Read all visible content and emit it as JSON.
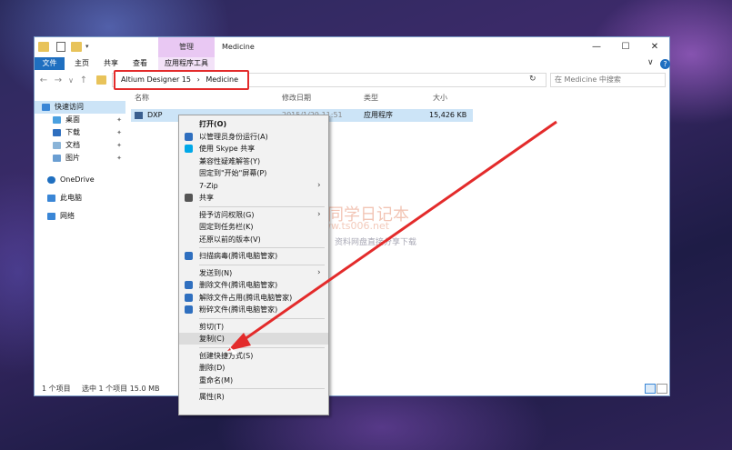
{
  "window": {
    "title": "Medicine",
    "context_tab_top": "管理",
    "controls": {
      "minimize": "—",
      "maximize": "☐",
      "close": "✕"
    },
    "chevron": "∨",
    "help": "?"
  },
  "ribbon": {
    "tabs": [
      "文件",
      "主页",
      "共享",
      "查看"
    ],
    "context_tab": "应用程序工具"
  },
  "address": {
    "crumbs": [
      "Altium Designer 15",
      "›",
      "Medicine"
    ],
    "search_placeholder": "在 Medicine 中搜索",
    "nav": {
      "back": "←",
      "forward": "→",
      "up": "↑",
      "down": "∨",
      "refresh": "↻"
    }
  },
  "nav_pane": {
    "quick_access": "快速访问",
    "items": [
      "桌面",
      "下载",
      "文档",
      "图片"
    ],
    "pin": "✦",
    "onedrive": "OneDrive",
    "thispc": "此电脑",
    "network": "网络"
  },
  "columns": {
    "name": "名称",
    "date": "修改日期",
    "type": "类型",
    "size": "大小"
  },
  "file": {
    "name": "DXP",
    "date": "2015/1/29 11:51",
    "type": "应用程序",
    "size": "15,426 KB"
  },
  "status": {
    "count": "1 个项目",
    "selected": "选中 1 个项目  15.0 MB"
  },
  "context_menu": {
    "items": [
      {
        "label": "打开(O)",
        "bold": true
      },
      {
        "label": "以管理员身份运行(A)",
        "icon": "shield-icon"
      },
      {
        "label": "使用 Skype 共享",
        "icon": "skype-icon"
      },
      {
        "label": "兼容性疑难解答(Y)"
      },
      {
        "label": "固定到\"开始\"屏幕(P)"
      },
      {
        "label": "7-Zip",
        "submenu": true
      },
      {
        "label": "共享",
        "icon": "share-icon"
      },
      {
        "sep": true
      },
      {
        "label": "授予访问权限(G)",
        "submenu": true
      },
      {
        "label": "固定到任务栏(K)"
      },
      {
        "label": "还原以前的版本(V)"
      },
      {
        "sep": true
      },
      {
        "label": "扫描病毒(腾讯电脑管家)",
        "icon": "scan-icon"
      },
      {
        "sep": true
      },
      {
        "label": "发送到(N)",
        "submenu": true
      },
      {
        "label": "删除文件(腾讯电脑管家)",
        "icon": "delete-file-icon"
      },
      {
        "label": "解除文件占用(腾讯电脑管家)",
        "icon": "unlock-icon"
      },
      {
        "label": "粉碎文件(腾讯电脑管家)",
        "icon": "shred-icon"
      },
      {
        "sep": true
      },
      {
        "label": "剪切(T)"
      },
      {
        "label": "复制(C)",
        "highlight": true
      },
      {
        "sep": true
      },
      {
        "label": "创建快捷方式(S)"
      },
      {
        "label": "删除(D)"
      },
      {
        "label": "重命名(M)"
      },
      {
        "sep": true
      },
      {
        "label": "属性(R)"
      }
    ],
    "submenu_glyph": "›"
  },
  "watermark": {
    "title": "丁同学日记本",
    "url": "www.ts006.net",
    "tagline": "软件、资源、资料网盘直接分享下载"
  },
  "colors": {
    "accent": "#1f6fc0",
    "annotation_red": "#e32b2b",
    "selection": "#cce4f7",
    "context_tab": "#e9c8f3"
  }
}
